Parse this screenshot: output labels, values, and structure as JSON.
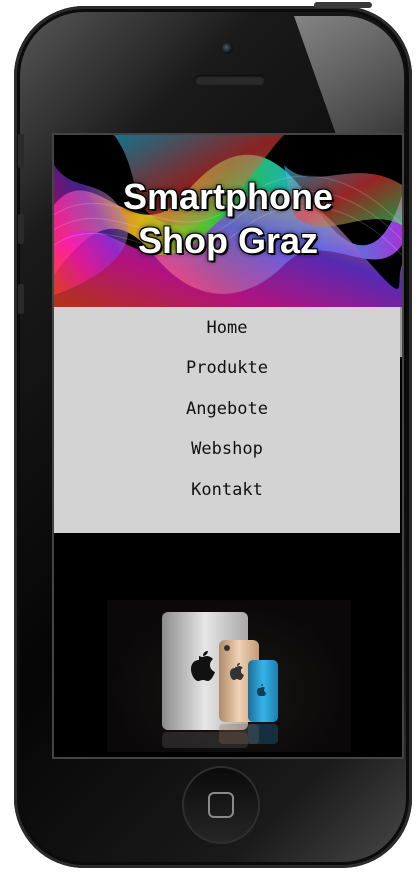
{
  "header": {
    "title_line1": "Smartphone",
    "title_line2": "Shop Graz"
  },
  "nav": {
    "items": [
      {
        "label": "Home"
      },
      {
        "label": "Produkte"
      },
      {
        "label": "Angebote"
      },
      {
        "label": "Webshop"
      },
      {
        "label": "Kontakt"
      }
    ]
  },
  "colors": {
    "nav_background": "#d3d3d3",
    "page_background": "#000000",
    "title_text": "#ffffff"
  },
  "icons": {
    "camera": "camera-icon",
    "home": "home-button-icon",
    "apple_logo": "apple-logo-icon"
  }
}
